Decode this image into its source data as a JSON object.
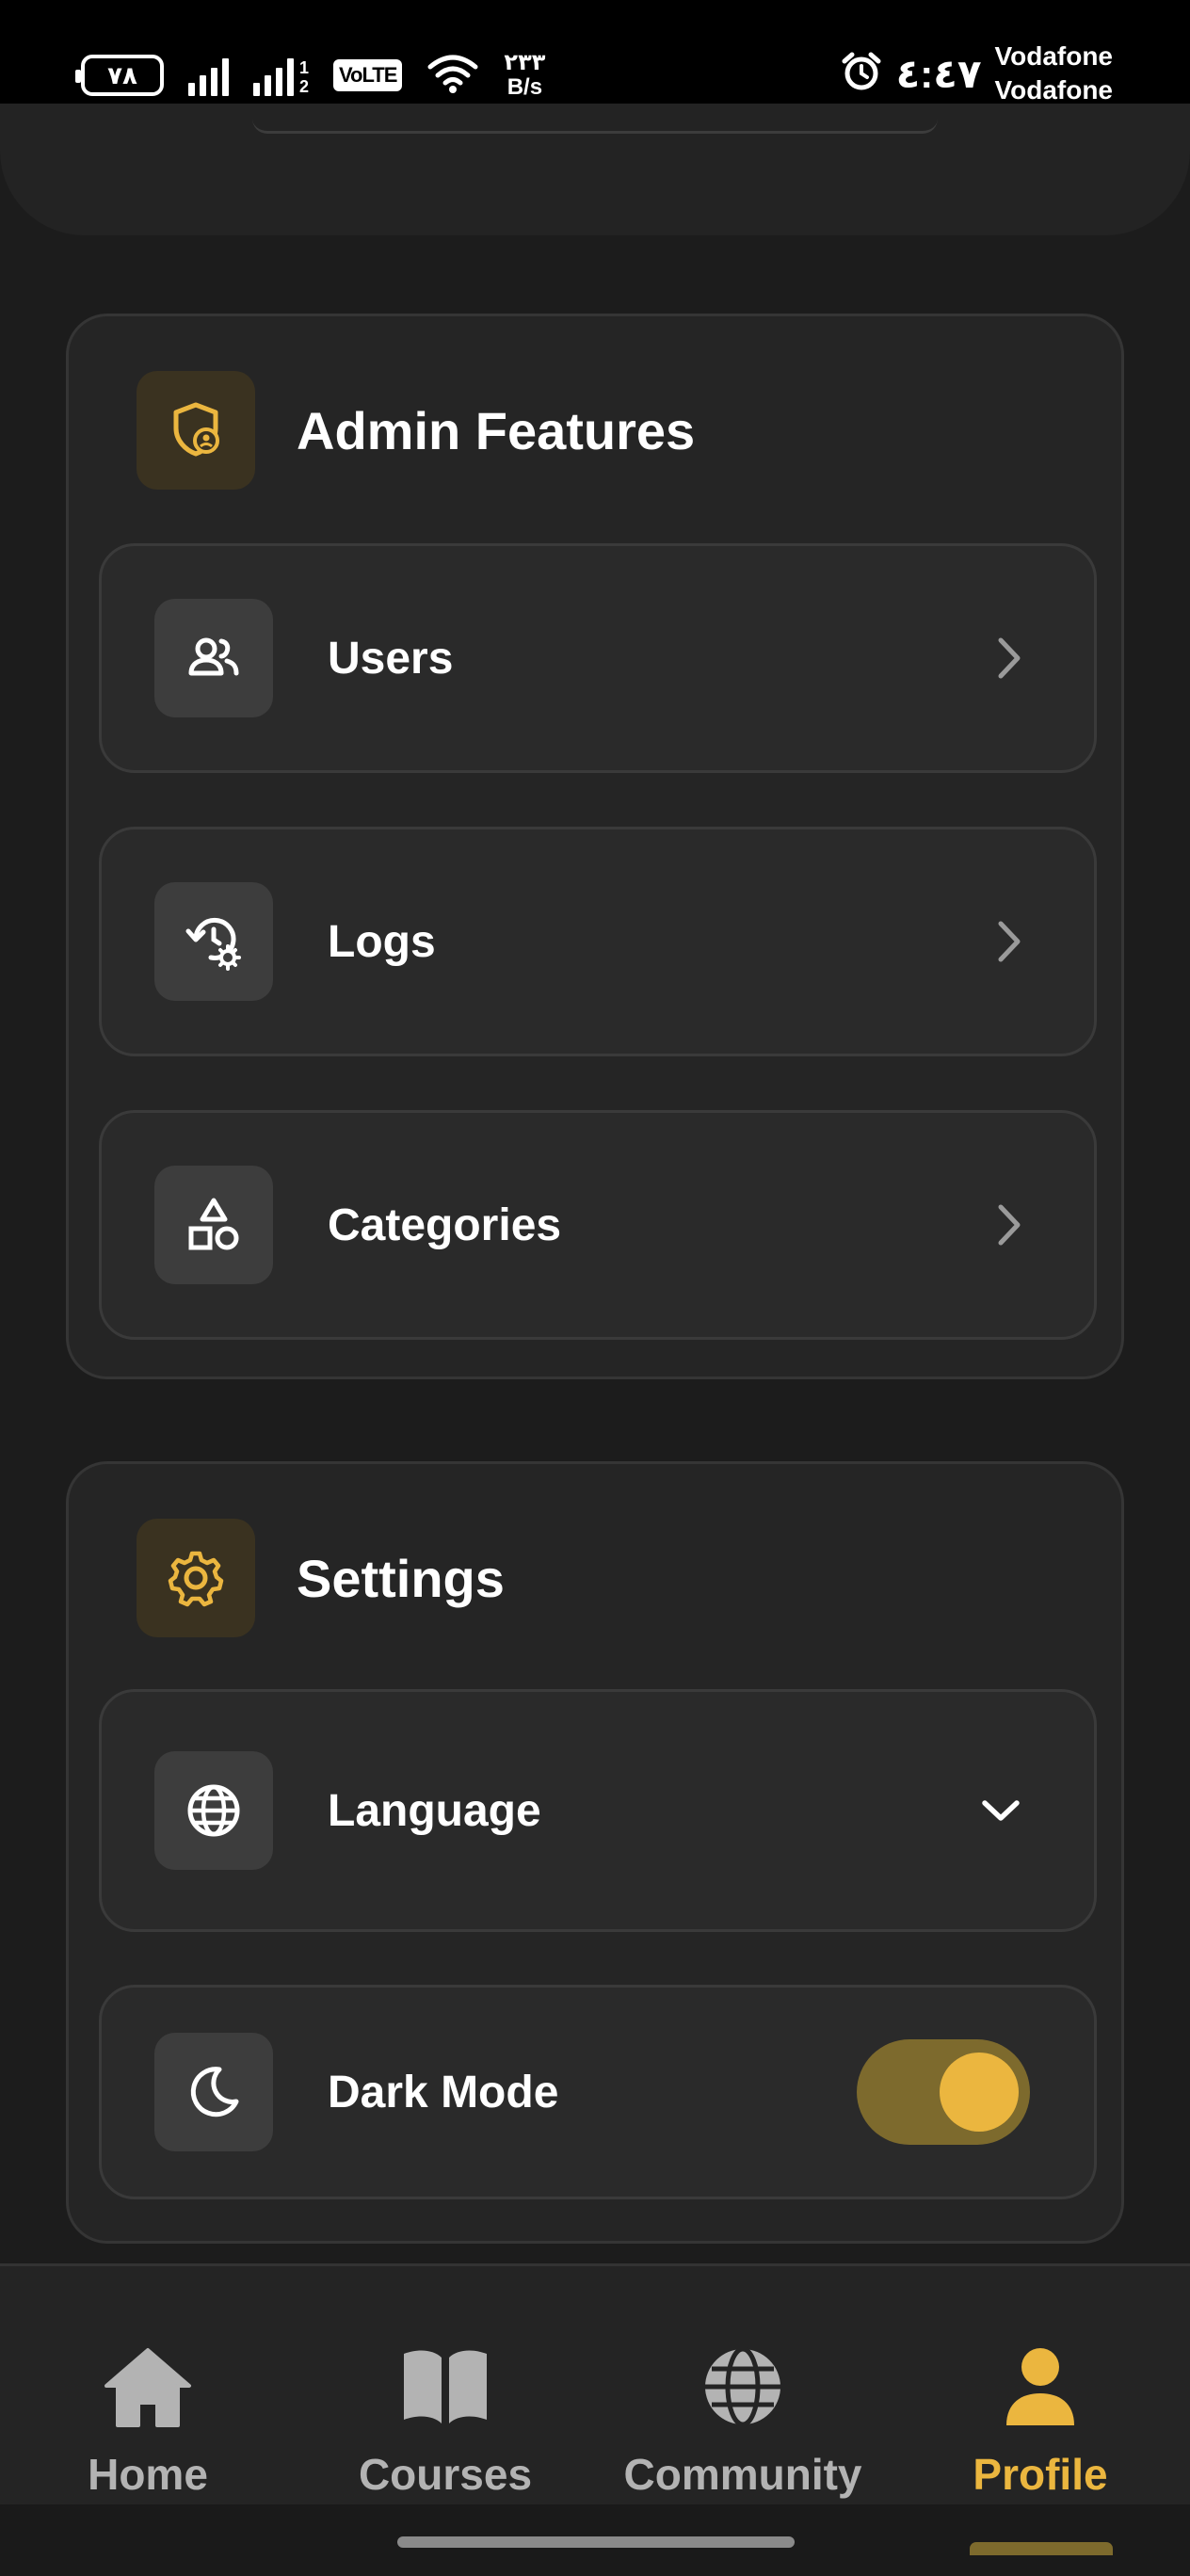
{
  "status_bar": {
    "battery": "٧٨",
    "sim2_numbers": [
      "1",
      "2"
    ],
    "volte": "VoLTE",
    "net_speed_value": "٢٣٣",
    "net_speed_unit": "B/s",
    "time": "٤:٤٧",
    "carrier1": "Vodafone",
    "carrier2": "Vodafone"
  },
  "admin_section": {
    "title": "Admin Features",
    "icon": "shield-person-icon",
    "items": [
      {
        "label": "Users",
        "icon": "users-icon"
      },
      {
        "label": "Logs",
        "icon": "history-settings-icon"
      },
      {
        "label": "Categories",
        "icon": "shapes-icon"
      }
    ]
  },
  "settings_section": {
    "title": "Settings",
    "icon": "gear-icon",
    "language": {
      "label": "Language",
      "icon": "globe-icon"
    },
    "dark_mode": {
      "label": "Dark Mode",
      "icon": "moon-icon",
      "enabled": true
    }
  },
  "bottom_nav": {
    "items": [
      {
        "label": "Home",
        "icon": "home-icon"
      },
      {
        "label": "Courses",
        "icon": "book-icon"
      },
      {
        "label": "Community",
        "icon": "globe-icon"
      },
      {
        "label": "Profile",
        "icon": "person-icon"
      }
    ],
    "active": "Profile"
  },
  "colors": {
    "accent": "#ebb63f",
    "accent_dim": "#7d6a2d",
    "background": "#1c1c1c",
    "card": "#252525",
    "item": "#2a2a2a"
  }
}
